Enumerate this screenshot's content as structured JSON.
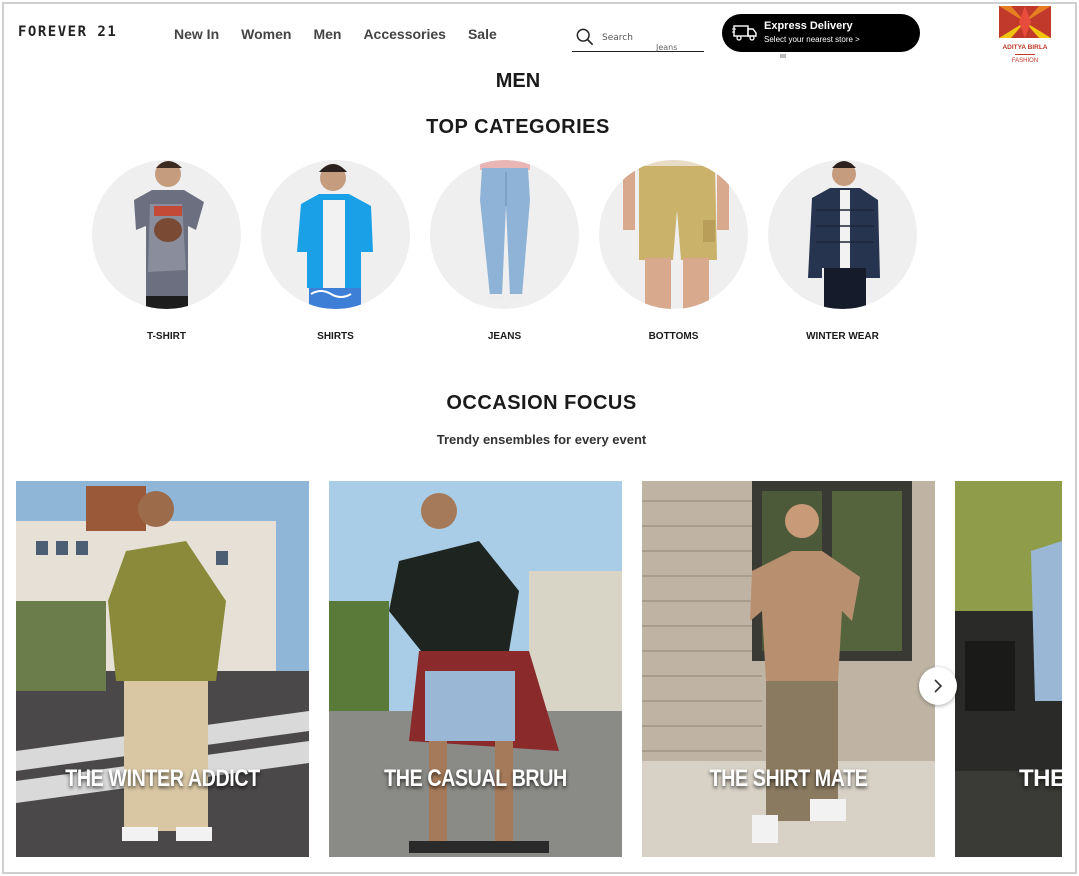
{
  "header": {
    "brand": "FOREVER 21",
    "nav": [
      "New In",
      "Women",
      "Men",
      "Accessories",
      "Sale"
    ],
    "search": {
      "placeholder": "Search",
      "hint": "Jeans"
    },
    "express": {
      "title": "Express Delivery",
      "subtitle": "Select your nearest store >"
    },
    "partner_logo": {
      "line1": "ADITYA BIRLA",
      "line2": "FASHION"
    }
  },
  "page_title": "MEN",
  "top_categories": {
    "title": "TOP CATEGORIES",
    "items": [
      {
        "label": "T-SHIRT",
        "icon": "tshirt-model-image"
      },
      {
        "label": "SHIRTS",
        "icon": "shirt-model-image"
      },
      {
        "label": "JEANS",
        "icon": "jeans-model-image"
      },
      {
        "label": "BOTTOMS",
        "icon": "shorts-model-image"
      },
      {
        "label": "WINTER WEAR",
        "icon": "jacket-model-image"
      }
    ]
  },
  "occasion": {
    "title": "OCCASION FOCUS",
    "subtitle": "Trendy ensembles for every event",
    "cards": [
      {
        "caption": "THE WINTER ADDICT"
      },
      {
        "caption": "THE CASUAL BRUH"
      },
      {
        "caption": "THE SHIRT MATE"
      },
      {
        "caption": "THE"
      }
    ]
  },
  "colors": {
    "accent": "#000000",
    "partner": "#c0392b"
  }
}
